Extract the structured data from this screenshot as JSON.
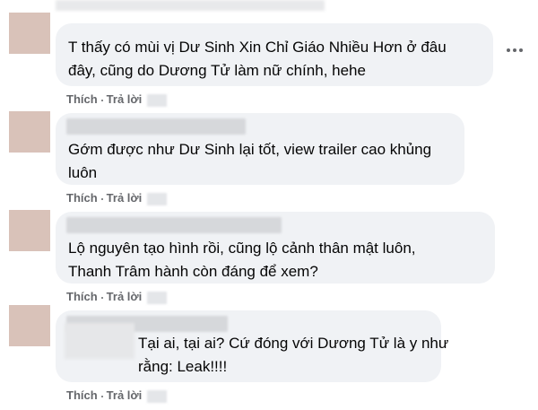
{
  "comments": [
    {
      "lines": [
        "T thấy có mùi vị Dư Sinh Xin Chỉ Giáo Nhiều Hơn ở đâu",
        "đây, cũng do Dương Tử làm nữ chính, hehe"
      ],
      "like_label": "Thích",
      "reply_label": "Trả lời"
    },
    {
      "lines": [
        "Gớm được như Dư Sinh lại tốt, view trailer cao khủng",
        "luôn"
      ],
      "like_label": "Thích",
      "reply_label": "Trả lời"
    },
    {
      "lines": [
        "Lộ nguyên tạo hình rồi, cũng lộ cảnh thân mật luôn,",
        "Thanh Trâm hành còn đáng để xem?"
      ],
      "like_label": "Thích",
      "reply_label": "Trả lời"
    },
    {
      "lines": [
        "Tại ai, tại ai? Cứ đóng với Dương Tử là y như",
        "rằng: Leak!!!!"
      ],
      "like_label": "Thích",
      "reply_label": "Trả lời"
    }
  ],
  "icons": {
    "more": "more-horizontal-icon"
  },
  "colors": {
    "bubble": "#f0f2f5",
    "avatar": "#d9c2b9",
    "meta_text": "#65676b"
  }
}
